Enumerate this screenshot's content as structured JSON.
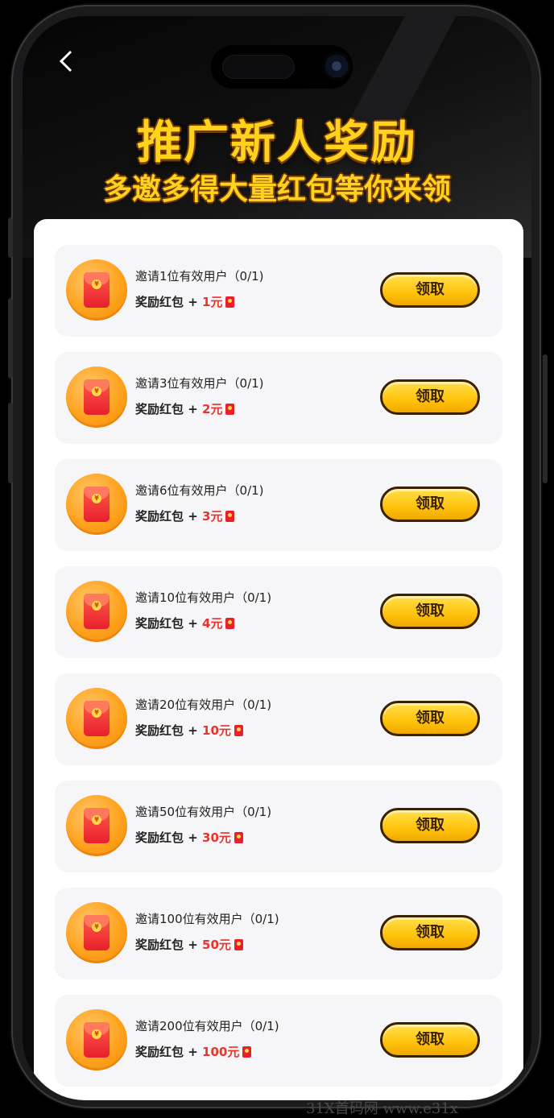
{
  "header": {
    "back_icon": "chevron-left-icon",
    "title": "推广新人奖励",
    "subtitle": "多邀多得大量红包等你来领"
  },
  "rewards": [
    {
      "task": "邀请1位有效用户（0/1)",
      "prefix": "奖励红包 + ",
      "amount": "1元",
      "button": "领取"
    },
    {
      "task": "邀请3位有效用户（0/1)",
      "prefix": "奖励红包 + ",
      "amount": "2元",
      "button": "领取"
    },
    {
      "task": "邀请6位有效用户（0/1)",
      "prefix": "奖励红包 + ",
      "amount": "3元",
      "button": "领取"
    },
    {
      "task": "邀请10位有效用户（0/1)",
      "prefix": "奖励红包 + ",
      "amount": "4元",
      "button": "领取"
    },
    {
      "task": "邀请20位有效用户（0/1)",
      "prefix": "奖励红包 + ",
      "amount": "10元",
      "button": "领取"
    },
    {
      "task": "邀请50位有效用户（0/1)",
      "prefix": "奖励红包 + ",
      "amount": "30元",
      "button": "领取"
    },
    {
      "task": "邀请100位有效用户（0/1)",
      "prefix": "奖励红包 + ",
      "amount": "50元",
      "button": "领取"
    },
    {
      "task": "邀请200位有效用户（0/1)",
      "prefix": "奖励红包 + ",
      "amount": "100元",
      "button": "领取"
    }
  ],
  "colors": {
    "title": "#ffd21e",
    "amount": "#e8342c",
    "button": "#ffc20a"
  },
  "watermark": "31X首码网 www.e31x"
}
